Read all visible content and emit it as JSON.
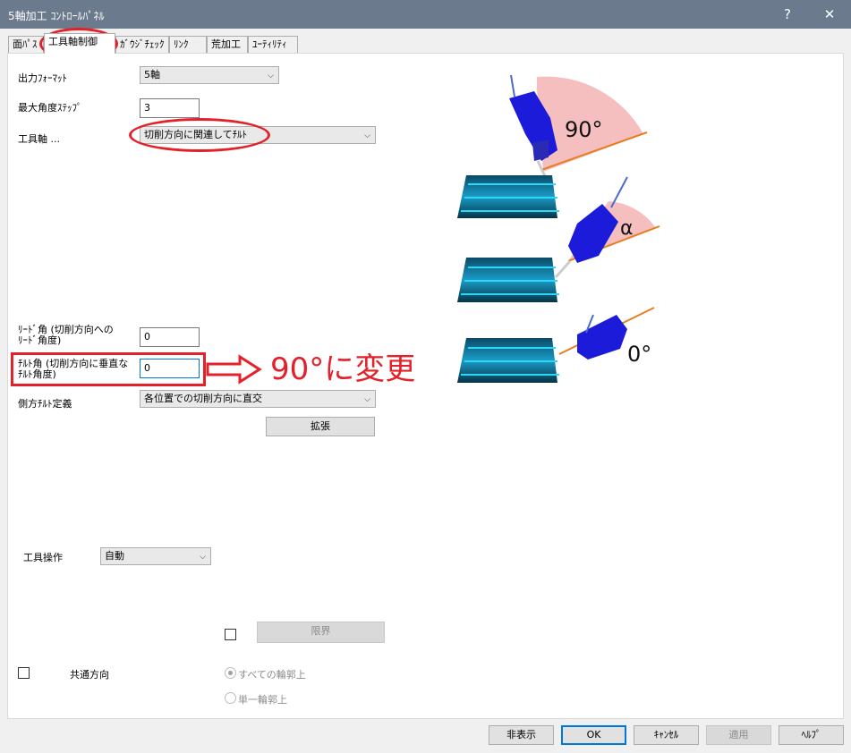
{
  "window": {
    "title": "5軸加工 ｺﾝﾄﾛｰﾙﾊﾟﾈﾙ",
    "help_label": "?",
    "close_label": "✕"
  },
  "tabs": [
    {
      "label": "面ﾊﾟｽ"
    },
    {
      "label": "工具軸制御",
      "active": true
    },
    {
      "label": "ｶﾞｳｼﾞﾁｪｯｸ"
    },
    {
      "label": "ﾘﾝｸ"
    },
    {
      "label": "荒加工"
    },
    {
      "label": "ﾕｰﾃｨﾘﾃｨ"
    }
  ],
  "form": {
    "output_format": {
      "label": "出力ﾌｫｰﾏｯﾄ",
      "value": "5軸"
    },
    "max_angle_step": {
      "label": "最大角度ｽﾃｯﾌﾟ",
      "value": "3"
    },
    "tool_axis": {
      "label": "工具軸 ...",
      "value": "切削方向に関連してﾁﾙﾄ"
    },
    "lead_angle": {
      "label_line1": "ﾘｰﾄﾞ角 (切削方向への",
      "label_line2": "ﾘｰﾄﾞ角度)",
      "value": "0"
    },
    "tilt_angle": {
      "label_line1": "ﾁﾙﾄ角 (切削方向に垂直な",
      "label_line2": "ﾁﾙﾄ角度)",
      "value": "0"
    },
    "side_tilt_def": {
      "label": "側方ﾁﾙﾄ定義",
      "value": "各位置での切削方向に直交"
    },
    "expand_button": "拡張",
    "tool_operation": {
      "label": "工具操作",
      "value": "自動"
    },
    "limit_button": "限界",
    "common_direction": {
      "label": "共通方向"
    },
    "radio_all": "すべての輪郭上",
    "radio_single": "単一輪郭上"
  },
  "annotation": {
    "text": "90°に変更",
    "color": "#e32128"
  },
  "illustration": {
    "labels": {
      "top": "90°",
      "middle": "α",
      "bottom": "0°"
    }
  },
  "footer": {
    "hide": "非表示",
    "ok": "OK",
    "cancel": "ｷｬﾝｾﾙ",
    "apply": "適用",
    "help": "ﾍﾙﾌﾟ"
  }
}
